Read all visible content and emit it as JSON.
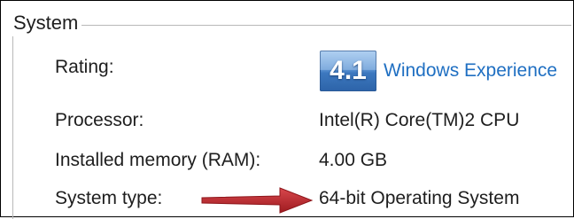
{
  "group": {
    "title": "System"
  },
  "rows": {
    "rating": {
      "label": "Rating:",
      "score": "4.1",
      "link": "Windows Experience"
    },
    "processor": {
      "label": "Processor:",
      "value": "Intel(R) Core(TM)2 CPU"
    },
    "memory": {
      "label": "Installed memory (RAM):",
      "value": "4.00 GB"
    },
    "system_type": {
      "label": "System type:",
      "value": "64-bit Operating System"
    }
  },
  "annotation": {
    "arrow_color": "#c1272d",
    "arrow_icon": "right-arrow-icon"
  },
  "colors": {
    "link": "#1f6fc2",
    "badge": "#3d78bf",
    "text": "#1e1e1e"
  }
}
